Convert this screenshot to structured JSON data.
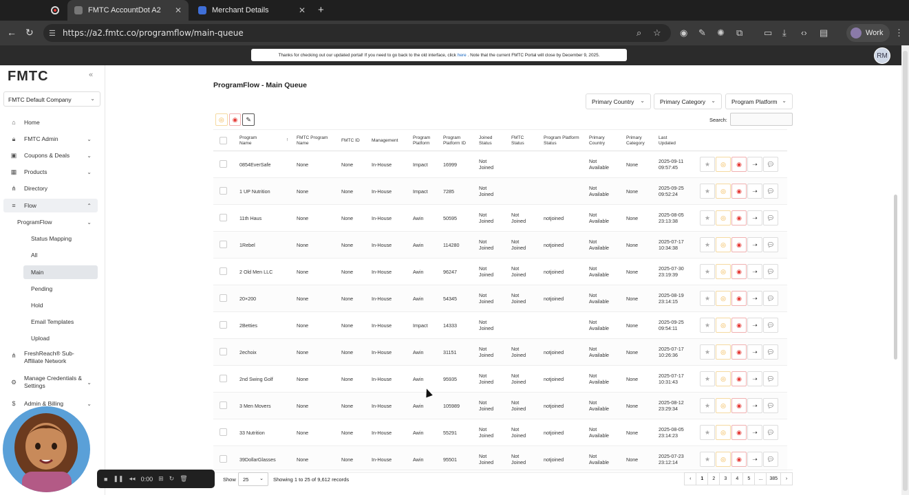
{
  "browser": {
    "tabs": [
      {
        "title": "FMTC AccountDot A2",
        "active": true
      },
      {
        "title": "Merchant Details",
        "active": false
      }
    ],
    "url": "https://a2.fmtc.co/programflow/main-queue",
    "profile_label": "Work"
  },
  "banner": {
    "text_before": "Thanks for checking out our updated portal! If you need to go back to the old interface, click",
    "link": "here",
    "text_after": ". Note that the current FMTC Portal will close by December 9, 2025."
  },
  "user_initials": "RM",
  "sidebar": {
    "logo": "FMTC",
    "company": "FMTC Default Company",
    "items": [
      {
        "label": "Home",
        "icon": "home-icon"
      },
      {
        "label": "FMTC Admin",
        "icon": "lock-icon"
      },
      {
        "label": "Coupons & Deals",
        "icon": "coupon-icon"
      },
      {
        "label": "Products",
        "icon": "product-icon"
      },
      {
        "label": "Directory",
        "icon": "directory-icon"
      },
      {
        "label": "Flow",
        "icon": "flow-icon"
      },
      {
        "label": "ProgramFlow",
        "icon": ""
      },
      {
        "label": "Status Mapping",
        "icon": ""
      },
      {
        "label": "All",
        "icon": ""
      },
      {
        "label": "Main",
        "icon": ""
      },
      {
        "label": "Pending",
        "icon": ""
      },
      {
        "label": "Hold",
        "icon": ""
      },
      {
        "label": "Email Templates",
        "icon": ""
      },
      {
        "label": "Upload",
        "icon": ""
      },
      {
        "label": "FreshReach® Sub-Affiliate Network",
        "icon": "network-icon"
      },
      {
        "label": "Manage Credentials & Settings",
        "icon": "credentials-icon"
      },
      {
        "label": "Admin & Billing",
        "icon": "billing-icon"
      }
    ]
  },
  "page": {
    "title": "ProgramFlow - Main Queue",
    "filters": [
      "Primary Country",
      "Primary Category",
      "Program Platform"
    ],
    "search_label": "Search:"
  },
  "table": {
    "headers": [
      "Program Name",
      "FMTC Program Name",
      "FMTC ID",
      "Management",
      "Program Platform",
      "Program Platform ID",
      "Joined Status",
      "FMTC Status",
      "Program Platform Status",
      "Primary Country",
      "Primary Category",
      "Last Updated"
    ],
    "rows": [
      [
        "0854EverSafe",
        "None",
        "None",
        "In-House",
        "Impact",
        "16999",
        "Not Joined",
        "",
        "",
        "Not Available",
        "None",
        "2025-09-11 09:57:45"
      ],
      [
        "1 UP Nutrition",
        "None",
        "None",
        "In-House",
        "Impact",
        "7285",
        "Not Joined",
        "",
        "",
        "Not Available",
        "None",
        "2025-09-25 09:52:24"
      ],
      [
        "11th Haus",
        "None",
        "None",
        "In-House",
        "Awin",
        "50595",
        "Not Joined",
        "Not Joined",
        "notjoined",
        "Not Available",
        "None",
        "2025-08-05 23:13:38"
      ],
      [
        "1Rebel",
        "None",
        "None",
        "In-House",
        "Awin",
        "114280",
        "Not Joined",
        "Not Joined",
        "notjoined",
        "Not Available",
        "None",
        "2025-07-17 10:34:38"
      ],
      [
        "2 Old Men LLC",
        "None",
        "None",
        "In-House",
        "Awin",
        "96247",
        "Not Joined",
        "Not Joined",
        "notjoined",
        "Not Available",
        "None",
        "2025-07-30 23:19:39"
      ],
      [
        "20×200",
        "None",
        "None",
        "In-House",
        "Awin",
        "54345",
        "Not Joined",
        "Not Joined",
        "notjoined",
        "Not Available",
        "None",
        "2025-08-19 23:14:15"
      ],
      [
        "2Betties",
        "None",
        "None",
        "In-House",
        "Impact",
        "14333",
        "Not Joined",
        "",
        "",
        "Not Available",
        "None",
        "2025-09-25 09:54:11"
      ],
      [
        "2echoix",
        "None",
        "None",
        "In-House",
        "Awin",
        "31151",
        "Not Joined",
        "Not Joined",
        "notjoined",
        "Not Available",
        "None",
        "2025-07-17 10:26:36"
      ],
      [
        "2nd Swing Golf",
        "None",
        "None",
        "In-House",
        "Awin",
        "95935",
        "Not Joined",
        "Not Joined",
        "notjoined",
        "Not Available",
        "None",
        "2025-07-17 10:31:43"
      ],
      [
        "3 Men Movers",
        "None",
        "None",
        "In-House",
        "Awin",
        "105989",
        "Not Joined",
        "Not Joined",
        "notjoined",
        "Not Available",
        "None",
        "2025-08-12 23:29:34"
      ],
      [
        "33 Nutrition",
        "None",
        "None",
        "In-House",
        "Awin",
        "55291",
        "Not Joined",
        "Not Joined",
        "notjoined",
        "Not Available",
        "None",
        "2025-08-05 23:14:23"
      ],
      [
        "39DollarGlasses",
        "None",
        "None",
        "In-House",
        "Awin",
        "95501",
        "Not Joined",
        "Not Joined",
        "notjoined",
        "Not Available",
        "None",
        "2025-07-23 23:12:14"
      ]
    ]
  },
  "footer": {
    "show_label": "Show",
    "page_size": "25",
    "records_text": "Showing 1 to 25 of 9,612 records",
    "pages": [
      "1",
      "2",
      "3",
      "4",
      "5",
      "...",
      "385"
    ]
  },
  "recorder": {
    "time": "0:00"
  },
  "colors": {
    "accent_red": "#e53935",
    "accent_yellow": "#f0b040",
    "sidebar_selected": "#e3e6ea"
  }
}
